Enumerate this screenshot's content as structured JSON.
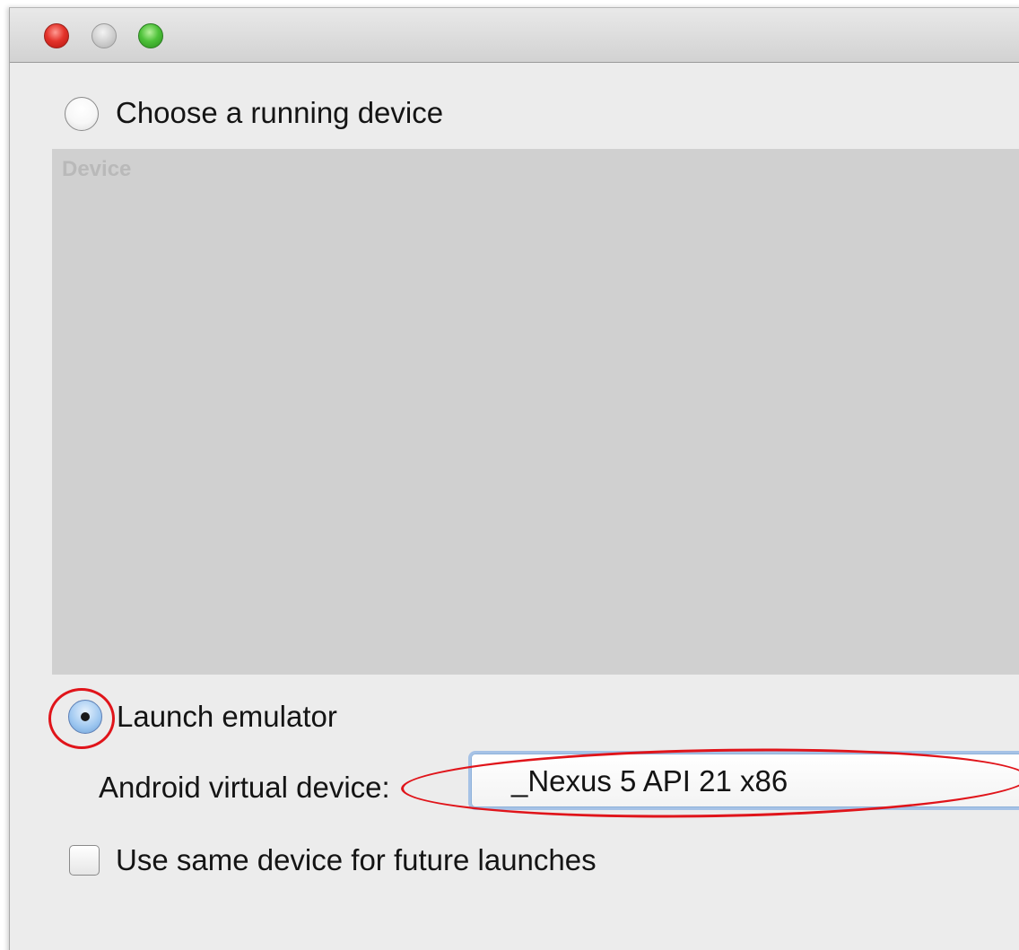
{
  "dialog": {
    "choose_running_device_label": "Choose a running device",
    "device_table": {
      "column_header": "Device",
      "rows": []
    },
    "launch_emulator_label": "Launch emulator",
    "avd_label": "Android virtual device:",
    "avd_selected": "_Nexus 5 API 21 x86",
    "same_device_label": "Use same device for future launches",
    "choose_running_device_selected": false,
    "launch_emulator_selected": true,
    "same_device_checked": false
  },
  "annotations": {
    "color": "#e0141a"
  }
}
